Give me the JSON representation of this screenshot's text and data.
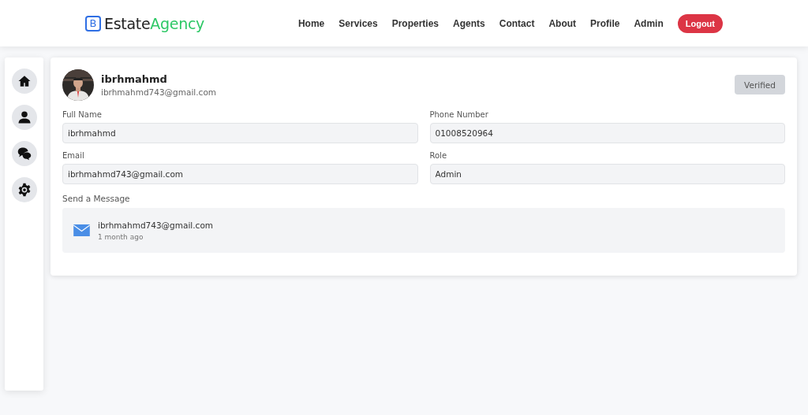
{
  "brand": {
    "badge": "B",
    "name": "Estate",
    "accent": "Agency"
  },
  "nav": [
    "Home",
    "Services",
    "Properties",
    "Agents",
    "Contact",
    "About",
    "Profile",
    "Admin"
  ],
  "logout": "Logout",
  "sidebar": [
    {
      "kind": "home"
    },
    {
      "kind": "user"
    },
    {
      "kind": "chat"
    },
    {
      "kind": "gear"
    }
  ],
  "profile": {
    "name": "ibrhmahmd",
    "email": "ibrhmahmd743@gmail.com",
    "status": {
      "label": "Verified",
      "disabled": true
    }
  },
  "fields": [
    {
      "label": "Full Name",
      "value": "ibrhmahmd"
    },
    {
      "label": "Phone Number",
      "value": "01008520964"
    },
    {
      "label": "Email",
      "value": "ibrhmahmd743@gmail.com"
    },
    {
      "label": "Role",
      "value": "Admin"
    }
  ],
  "messages": {
    "title": "Send a Message",
    "items": [
      {
        "sender": "ibrhmahmd743@gmail.com",
        "time": "1 month ago"
      }
    ]
  }
}
